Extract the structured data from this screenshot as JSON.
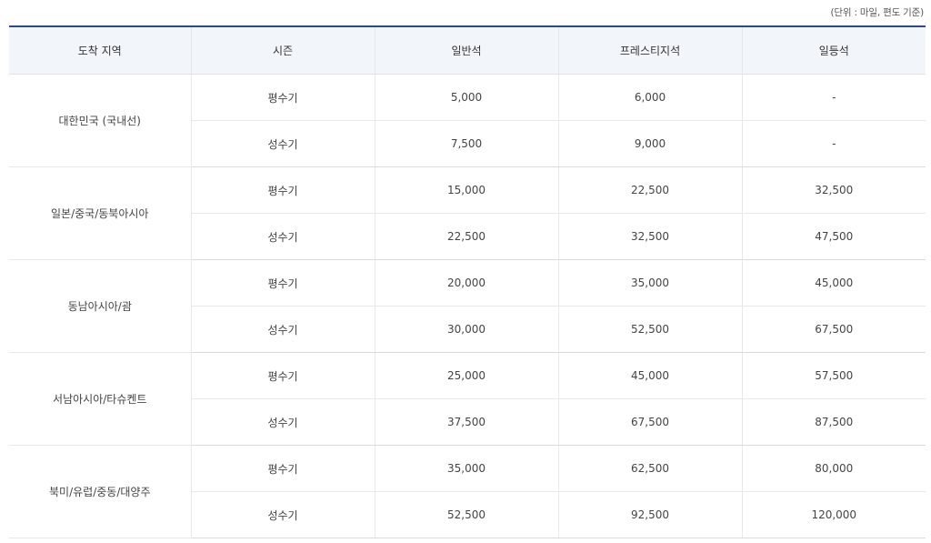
{
  "unit_note": "(단위 : 마일, 편도 기준)",
  "headers": [
    "도착 지역",
    "시즌",
    "일반석",
    "프레스티지석",
    "일등석"
  ],
  "regions": [
    {
      "name": "대한민국 (국내선)",
      "rows": [
        {
          "season": "평수기",
          "economy": "5,000",
          "prestige": "6,000",
          "first": "-"
        },
        {
          "season": "성수기",
          "economy": "7,500",
          "prestige": "9,000",
          "first": "-"
        }
      ]
    },
    {
      "name": "일본/중국/동북아시아",
      "rows": [
        {
          "season": "평수기",
          "economy": "15,000",
          "prestige": "22,500",
          "first": "32,500"
        },
        {
          "season": "성수기",
          "economy": "22,500",
          "prestige": "32,500",
          "first": "47,500"
        }
      ]
    },
    {
      "name": "동남아시아/괌",
      "rows": [
        {
          "season": "평수기",
          "economy": "20,000",
          "prestige": "35,000",
          "first": "45,000"
        },
        {
          "season": "성수기",
          "economy": "30,000",
          "prestige": "52,500",
          "first": "67,500"
        }
      ]
    },
    {
      "name": "서남아시아/타슈켄트",
      "rows": [
        {
          "season": "평수기",
          "economy": "25,000",
          "prestige": "45,000",
          "first": "57,500"
        },
        {
          "season": "성수기",
          "economy": "37,500",
          "prestige": "67,500",
          "first": "87,500"
        }
      ]
    },
    {
      "name": "북미/유럽/중동/대양주",
      "rows": [
        {
          "season": "평수기",
          "economy": "35,000",
          "prestige": "62,500",
          "first": "80,000"
        },
        {
          "season": "성수기",
          "economy": "52,500",
          "prestige": "92,500",
          "first": "120,000"
        }
      ]
    }
  ]
}
